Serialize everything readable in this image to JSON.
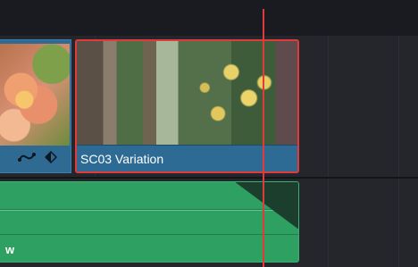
{
  "timeline": {
    "selected_clip": {
      "name": "SC03 Variation"
    },
    "audio_clip": {
      "name_fragment": "w"
    },
    "left_clip_icons": [
      "curve-icon",
      "keyframe-diamond-icon"
    ],
    "colors": {
      "video_clip": "#2e6b94",
      "selection_outline": "#e03a3a",
      "audio_clip": "#2ea062",
      "playhead": "#e03a3a"
    }
  }
}
